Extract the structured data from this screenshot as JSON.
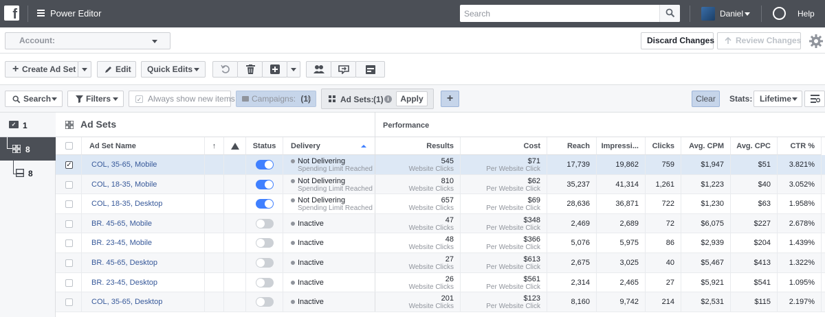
{
  "topbar": {
    "title": "Power Editor",
    "search_placeholder": "Search",
    "user": "Daniel",
    "help": "Help",
    "fb_letter": "f"
  },
  "toolbar1": {
    "account_label": "Account:",
    "discard": "Discard Changes",
    "review": "Review Changes"
  },
  "toolbar2": {
    "create": "Create Ad Set",
    "edit": "Edit",
    "quick_edits": "Quick Edits"
  },
  "filterbar": {
    "search": "Search",
    "filters": "Filters",
    "always_show": "Always show new items",
    "campaigns_chip": "Campaigns:",
    "campaigns_count": "(1)",
    "adsets_chip": "Ad Sets:",
    "adsets_count": "(1)",
    "apply": "Apply",
    "clear": "Clear",
    "stats_label": "Stats:",
    "stats_value": "Lifetime"
  },
  "sidebar": {
    "campaigns_count": "1",
    "adsets_count": "8",
    "ads_count": "8"
  },
  "panel": {
    "title": "Ad Sets",
    "performance": "Performance"
  },
  "columns": {
    "name": "Ad Set Name",
    "status": "Status",
    "delivery": "Delivery",
    "results": "Results",
    "cost": "Cost",
    "reach": "Reach",
    "impressions": "Impressi...",
    "clicks": "Clicks",
    "avg_cpm": "Avg. CPM",
    "avg_cpc": "Avg. CPC",
    "ctr": "CTR %"
  },
  "rows": [
    {
      "name": "COL, 35-65, Mobile",
      "on": true,
      "selected": true,
      "delivery": "Not Delivering",
      "delivery_sub": "Spending Limit Reached",
      "results": "545",
      "results_sub": "Website Clicks",
      "cost": "$71",
      "cost_sub": "Per Website Click",
      "reach": "17,739",
      "impressions": "19,862",
      "clicks": "759",
      "cpm": "$1,947",
      "cpc": "$51",
      "ctr": "3.821%"
    },
    {
      "name": "COL, 18-35, Mobile",
      "on": true,
      "selected": false,
      "delivery": "Not Delivering",
      "delivery_sub": "Spending Limit Reached",
      "results": "810",
      "results_sub": "Website Clicks",
      "cost": "$62",
      "cost_sub": "Per Website Click",
      "reach": "35,237",
      "impressions": "41,314",
      "clicks": "1,261",
      "cpm": "$1,223",
      "cpc": "$40",
      "ctr": "3.052%"
    },
    {
      "name": "COL, 18-35, Desktop",
      "on": true,
      "selected": false,
      "delivery": "Not Delivering",
      "delivery_sub": "Spending Limit Reached",
      "results": "657",
      "results_sub": "Website Clicks",
      "cost": "$69",
      "cost_sub": "Per Website Click",
      "reach": "28,636",
      "impressions": "36,871",
      "clicks": "722",
      "cpm": "$1,230",
      "cpc": "$63",
      "ctr": "1.958%"
    },
    {
      "name": "BR. 45-65, Mobile",
      "on": false,
      "selected": false,
      "delivery": "Inactive",
      "delivery_sub": "",
      "results": "47",
      "results_sub": "Website Clicks",
      "cost": "$348",
      "cost_sub": "Per Website Click",
      "reach": "2,469",
      "impressions": "2,689",
      "clicks": "72",
      "cpm": "$6,075",
      "cpc": "$227",
      "ctr": "2.678%"
    },
    {
      "name": "BR. 23-45, Mobile",
      "on": false,
      "selected": false,
      "delivery": "Inactive",
      "delivery_sub": "",
      "results": "48",
      "results_sub": "Website Clicks",
      "cost": "$366",
      "cost_sub": "Per Website Click",
      "reach": "5,076",
      "impressions": "5,975",
      "clicks": "86",
      "cpm": "$2,939",
      "cpc": "$204",
      "ctr": "1.439%"
    },
    {
      "name": "BR. 45-65, Desktop",
      "on": false,
      "selected": false,
      "delivery": "Inactive",
      "delivery_sub": "",
      "results": "27",
      "results_sub": "Website Clicks",
      "cost": "$613",
      "cost_sub": "Per Website Click",
      "reach": "2,675",
      "impressions": "3,025",
      "clicks": "40",
      "cpm": "$5,467",
      "cpc": "$413",
      "ctr": "1.322%"
    },
    {
      "name": "BR. 23-45, Desktop",
      "on": false,
      "selected": false,
      "delivery": "Inactive",
      "delivery_sub": "",
      "results": "26",
      "results_sub": "Website Clicks",
      "cost": "$561",
      "cost_sub": "Per Website Click",
      "reach": "2,314",
      "impressions": "2,465",
      "clicks": "27",
      "cpm": "$5,921",
      "cpc": "$541",
      "ctr": "1.095%"
    },
    {
      "name": "COL, 35-65, Desktop",
      "on": false,
      "selected": false,
      "delivery": "Inactive",
      "delivery_sub": "",
      "results": "201",
      "results_sub": "Website Clicks",
      "cost": "$123",
      "cost_sub": "Per Website Click",
      "reach": "8,160",
      "impressions": "9,742",
      "clicks": "214",
      "cpm": "$2,531",
      "cpc": "$115",
      "ctr": "2.197%"
    }
  ]
}
